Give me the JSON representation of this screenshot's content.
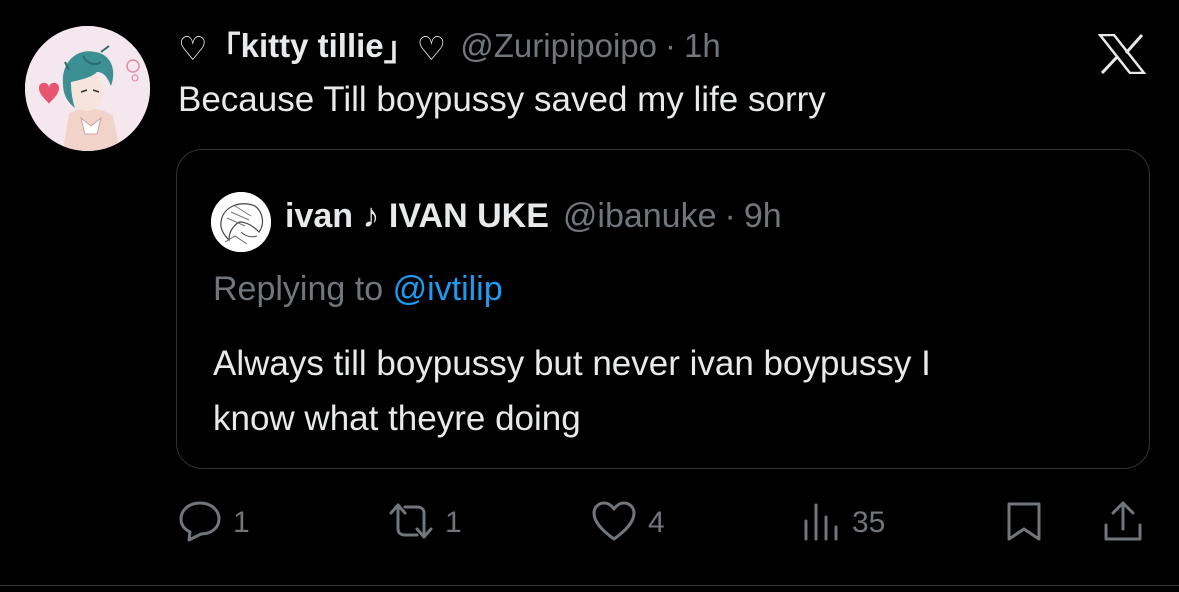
{
  "tweet": {
    "display_name_prefix": "♡「",
    "display_name_core": "kitty tillie",
    "display_name_suffix": "」♡",
    "handle": "@Zuripipoipo",
    "separator": "·",
    "time": "1h",
    "text": "Because Till boypussy saved my life sorry"
  },
  "quote": {
    "display_name": "ivan ♪ IVAN UKE",
    "handle": "@ibanuke",
    "separator": "·",
    "time": "9h",
    "replying_label": "Replying to",
    "replying_to": "@ivtilip",
    "text_line1": "Always till boypussy but never ivan boypussy I",
    "text_line2": "know what theyre doing"
  },
  "actions": {
    "reply_count": "1",
    "retweet_count": "1",
    "like_count": "4",
    "views_count": "35"
  },
  "icons": {
    "reply": "reply-icon",
    "retweet": "retweet-icon",
    "like": "heart-icon",
    "views": "views-icon",
    "bookmark": "bookmark-icon",
    "share": "share-icon",
    "close": "x-logo-icon"
  },
  "colors": {
    "background": "#000000",
    "text_primary": "#e7e9ea",
    "text_secondary": "#71767b",
    "link": "#1d9bf0",
    "border": "#2f3336"
  }
}
